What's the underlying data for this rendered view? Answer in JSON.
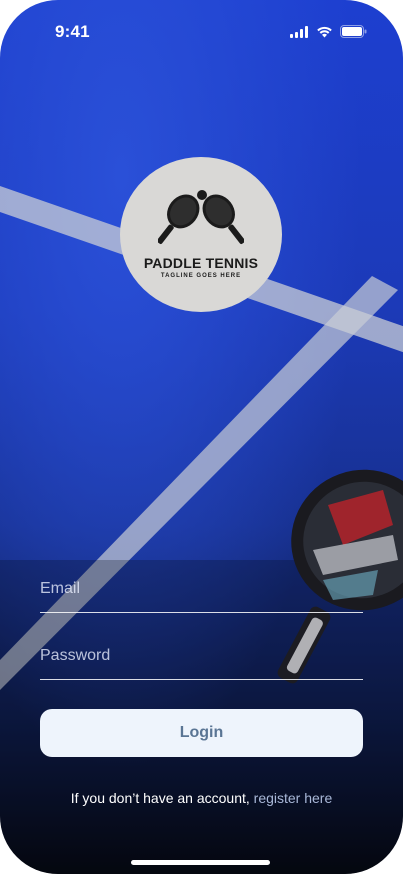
{
  "status_bar": {
    "time": "9:41",
    "icons": [
      "signal-icon",
      "wifi-icon",
      "battery-icon"
    ]
  },
  "logo": {
    "title": "PADDLE TENNIS",
    "tagline": "TAGLINE GOES HERE"
  },
  "form": {
    "email_placeholder": "Email",
    "password_placeholder": "Password",
    "login_label": "Login"
  },
  "register": {
    "prompt": "If you don’t have an account,",
    "link_label": "register here"
  },
  "colors": {
    "court_blue": "#1c3ab8",
    "button_bg": "#eef4fc",
    "button_text": "#5a7594",
    "link": "#a9b8d8"
  }
}
